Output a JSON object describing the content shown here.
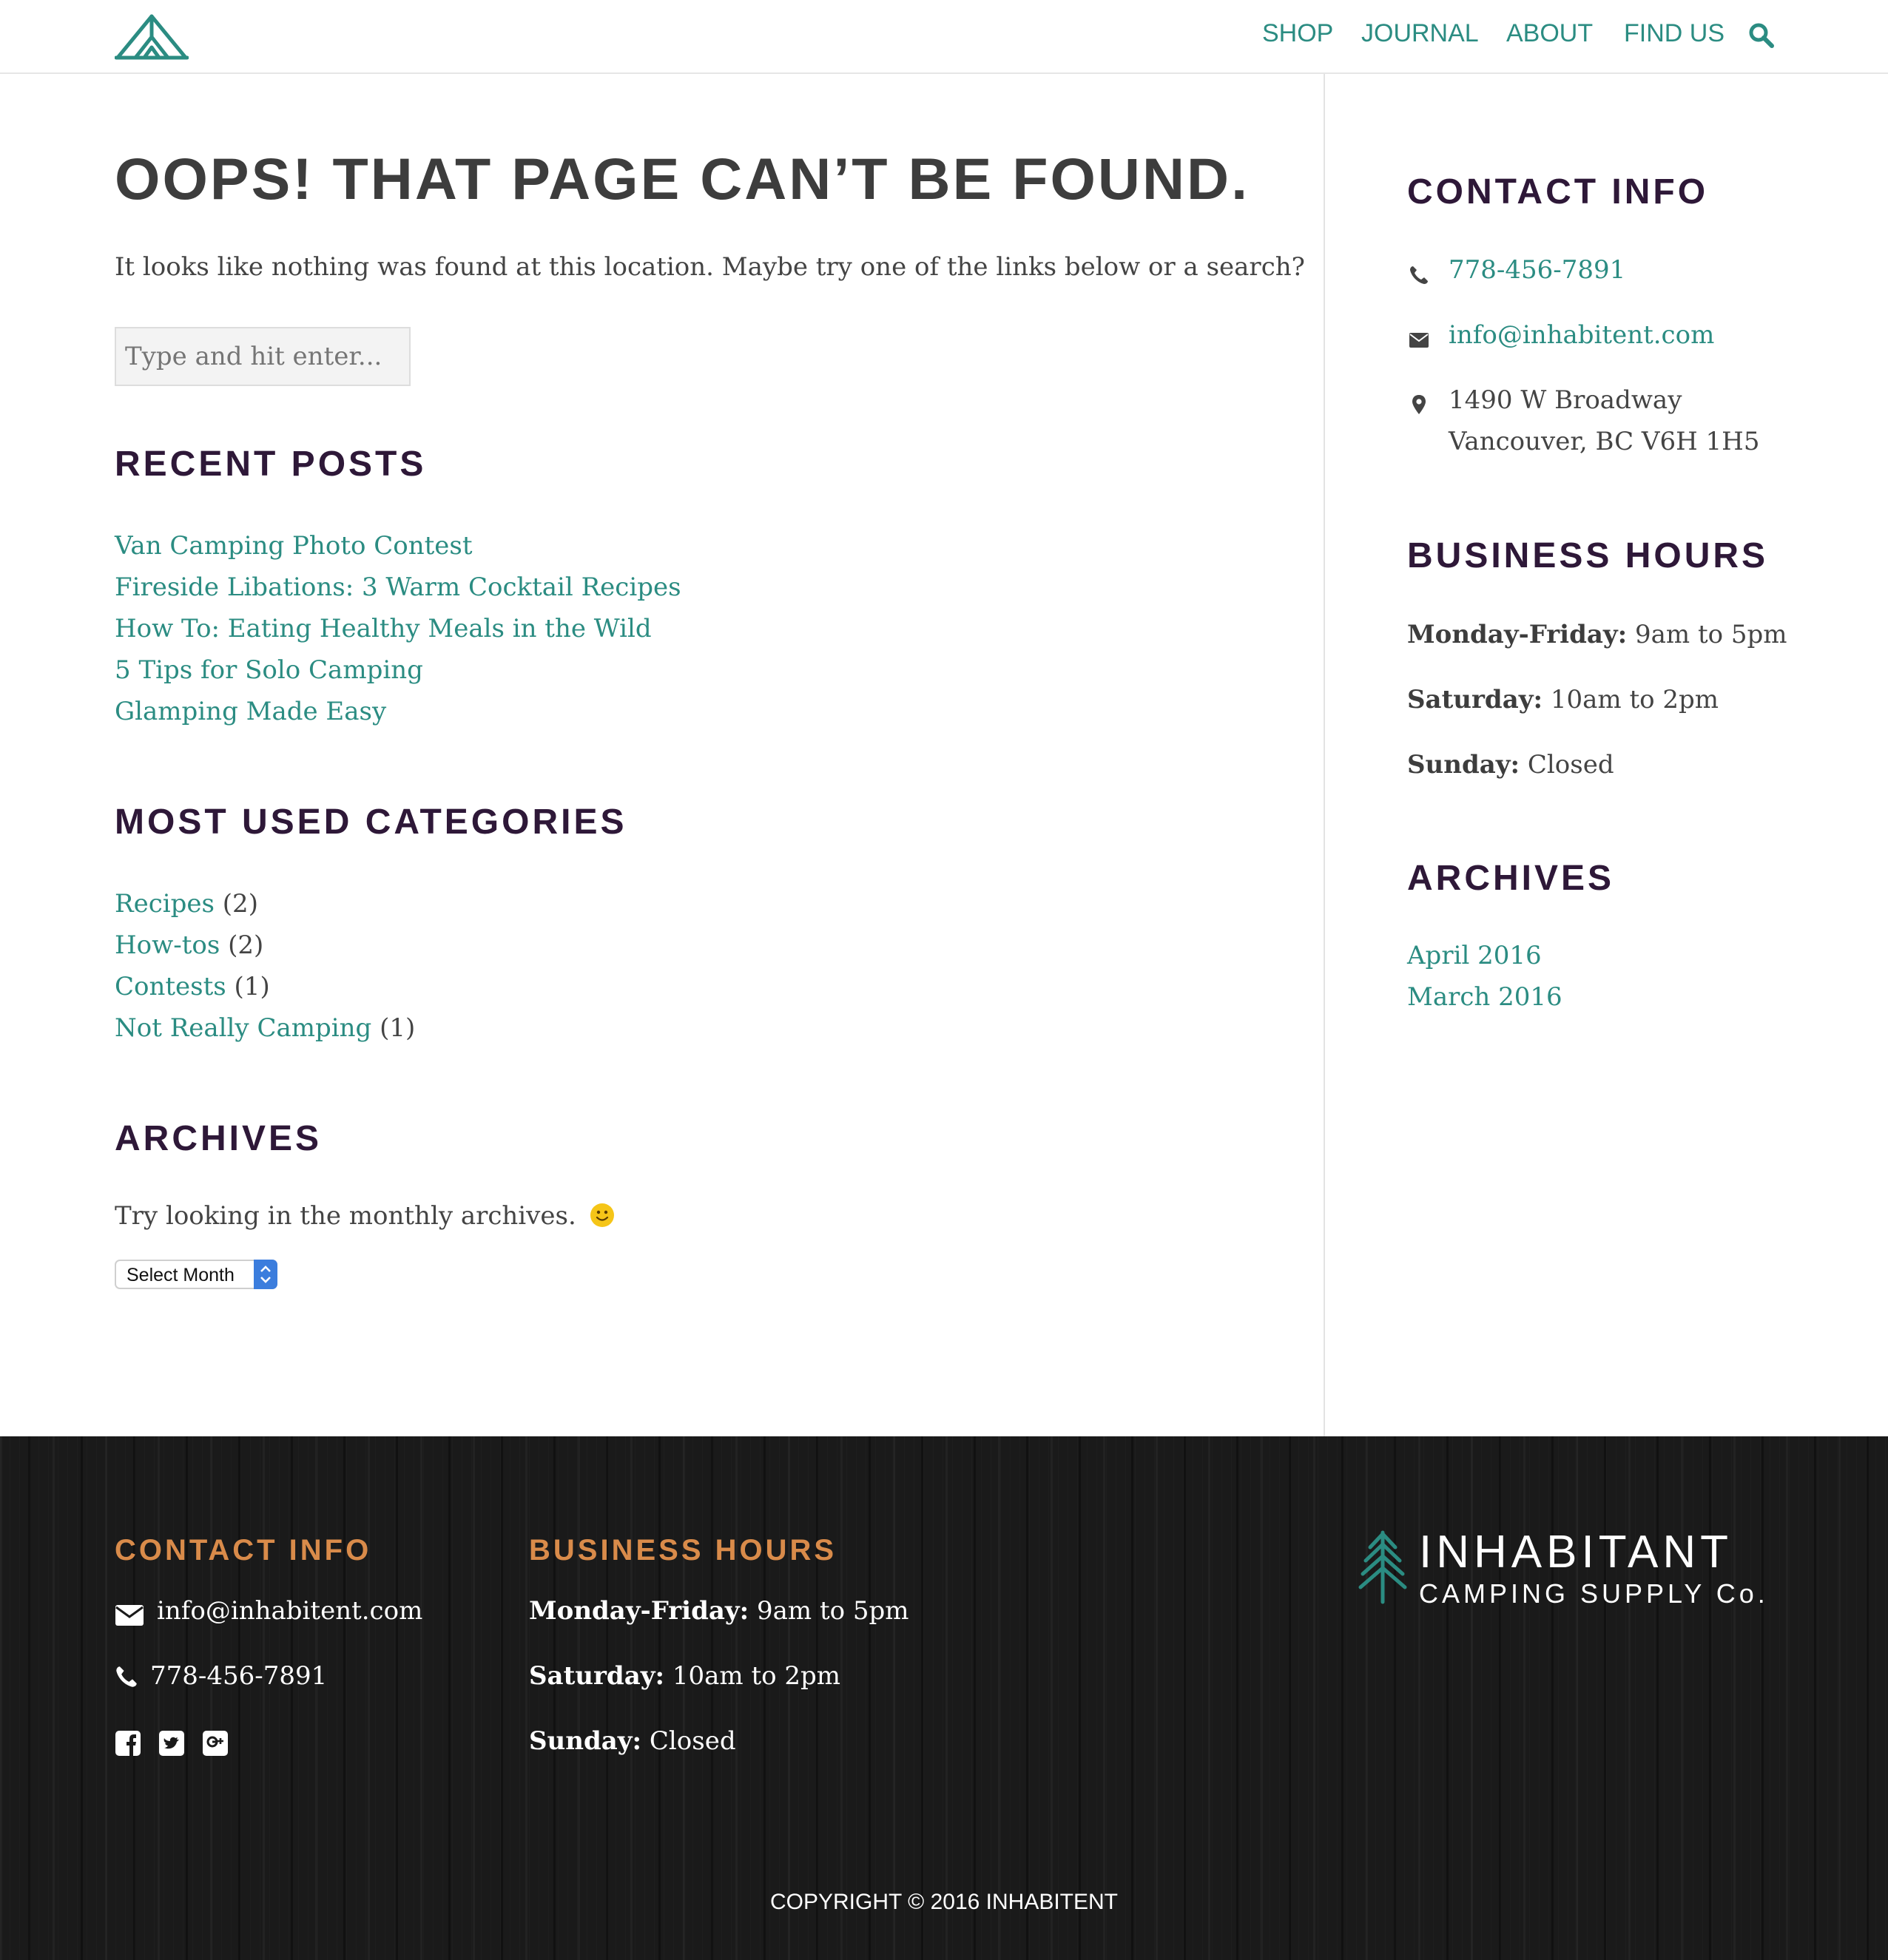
{
  "header": {
    "nav": [
      "SHOP",
      "JOURNAL",
      "ABOUT",
      "FIND US"
    ]
  },
  "main": {
    "title": "OOPS! THAT PAGE CAN’T BE FOUND.",
    "intro": "It looks like nothing was found at this location. Maybe try one of the links below or a search?",
    "search_placeholder": "Type and hit enter...",
    "recent_posts": {
      "heading": "RECENT POSTS",
      "items": [
        "Van Camping Photo Contest",
        "Fireside Libations: 3 Warm Cocktail Recipes",
        "How To: Eating Healthy Meals in the Wild",
        "5 Tips for Solo Camping",
        "Glamping Made Easy"
      ]
    },
    "categories": {
      "heading": "MOST USED CATEGORIES",
      "items": [
        {
          "name": "Recipes",
          "count": "(2)"
        },
        {
          "name": "How-tos",
          "count": "(2)"
        },
        {
          "name": "Contests",
          "count": "(1)"
        },
        {
          "name": "Not Really Camping",
          "count": "(1)"
        }
      ]
    },
    "archives": {
      "heading": "ARCHIVES",
      "note": "Try looking in the monthly archives.",
      "select_label": "Select Month"
    }
  },
  "sidebar": {
    "contact": {
      "heading": "CONTACT INFO",
      "phone": "778-456-7891",
      "email": "info@inhabitent.com",
      "address_line1": "1490 W Broadway",
      "address_line2": "Vancouver, BC V6H 1H5"
    },
    "hours": {
      "heading": "BUSINESS HOURS",
      "rows": [
        {
          "day": "Monday-Friday:",
          "time": "9am to 5pm"
        },
        {
          "day": "Saturday:",
          "time": "10am to 2pm"
        },
        {
          "day": "Sunday:",
          "time": "Closed"
        }
      ]
    },
    "archives": {
      "heading": "ARCHIVES",
      "items": [
        "April 2016",
        "March 2016"
      ]
    }
  },
  "footer": {
    "contact_heading": "CONTACT INFO",
    "email": "info@inhabitent.com",
    "phone": "778-456-7891",
    "hours_heading": "BUSINESS HOURS",
    "hours": [
      {
        "day": "Monday-Friday:",
        "time": "9am to 5pm"
      },
      {
        "day": "Saturday:",
        "time": "10am to 2pm"
      },
      {
        "day": "Sunday:",
        "time": "Closed"
      }
    ],
    "brand_name": "INHABITANT",
    "brand_tagline": "CAMPING SUPPLY Co.",
    "copyright": "COPYRIGHT © 2016 INHABITENT"
  },
  "colors": {
    "teal": "#2b8c82",
    "heading_purple": "#2e1838",
    "footer_orange": "#d98b4a",
    "footer_bg": "#1a1a1a"
  },
  "icons": [
    "tent-logo-icon",
    "search-icon",
    "phone-icon",
    "envelope-icon",
    "map-pin-icon",
    "facebook-icon",
    "twitter-icon",
    "google-plus-icon",
    "tree-logo-icon",
    "smiley-icon",
    "select-arrows-icon"
  ]
}
